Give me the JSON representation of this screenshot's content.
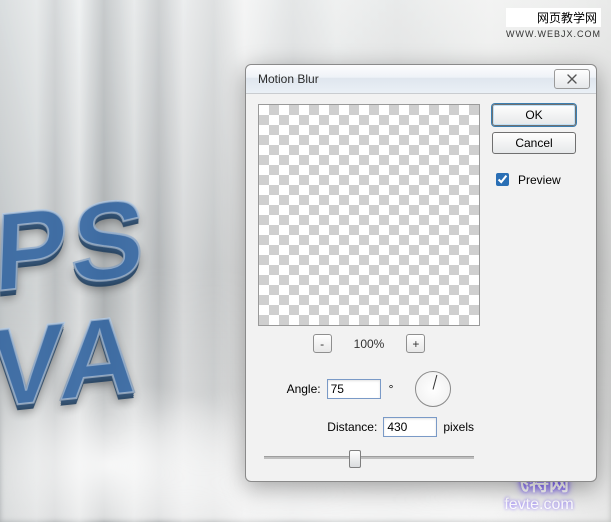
{
  "watermark": {
    "top_title": "网页教学网",
    "top_sub": "www.webjx.com",
    "brand": "飞特网",
    "domain": "fevte.com"
  },
  "canvas": {
    "line1": "PS",
    "line2": "VA"
  },
  "dialog": {
    "title": "Motion Blur",
    "close_icon": "close-icon",
    "ok": "OK",
    "cancel": "Cancel",
    "preview_label": "Preview",
    "preview_checked": true,
    "zoom": {
      "out_label": "-",
      "in_label": "+",
      "level": "100%"
    },
    "angle": {
      "label": "Angle:",
      "value": "75",
      "unit": "°"
    },
    "distance": {
      "label": "Distance:",
      "value": "430",
      "unit": "pixels",
      "slider_min": 1,
      "slider_max": 999,
      "slider_pos_pct": 43
    }
  }
}
